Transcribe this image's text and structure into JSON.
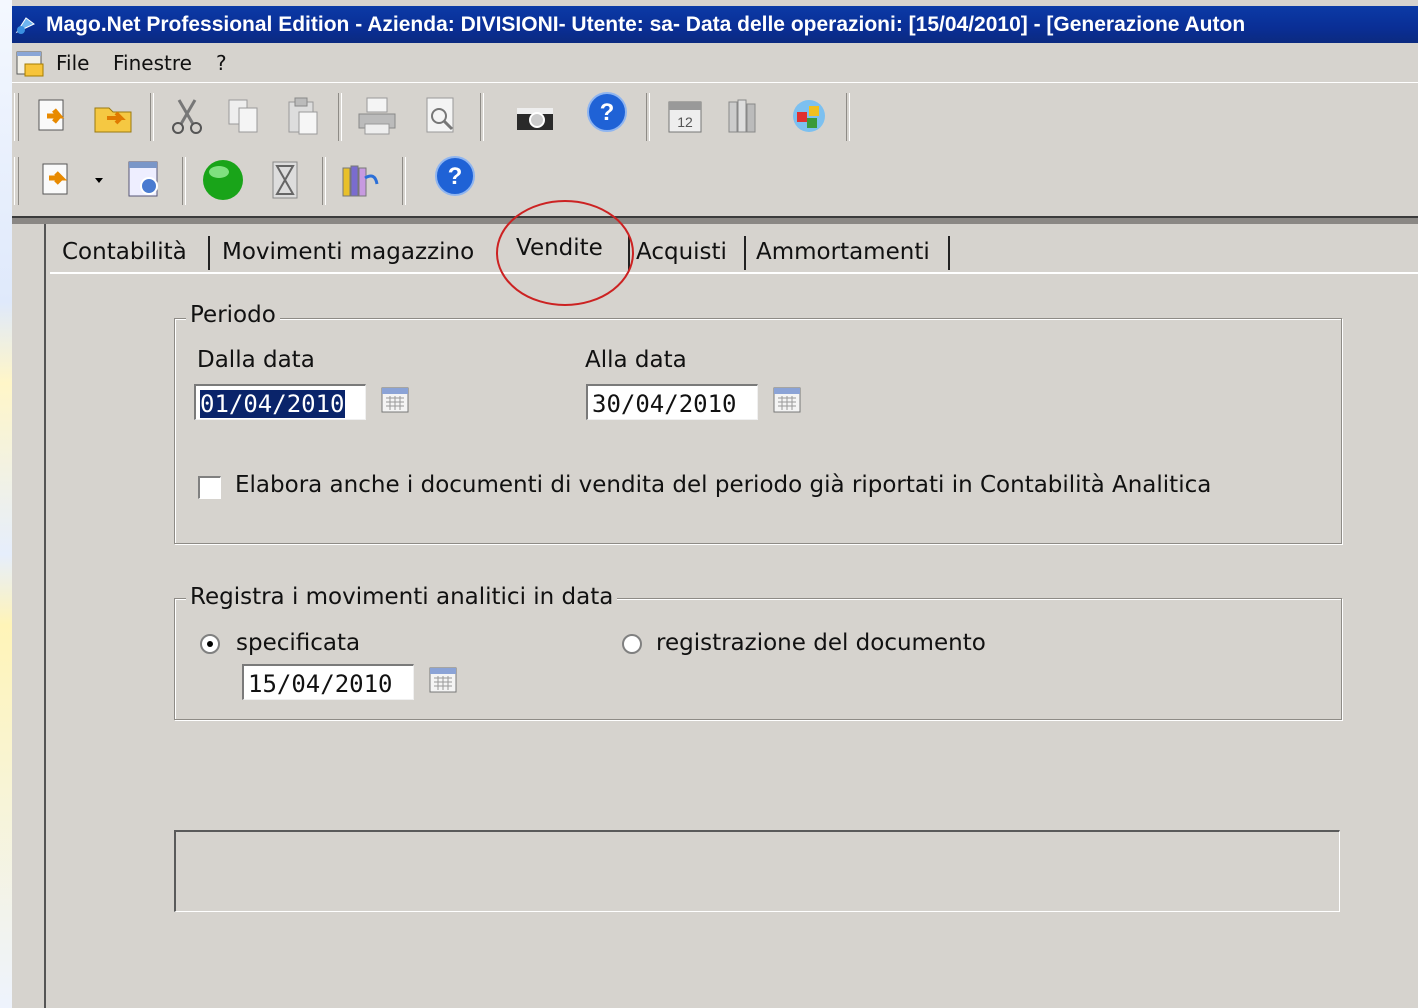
{
  "window": {
    "title": "Mago.Net Professional Edition - Azienda: DIVISIONI- Utente: sa- Data delle operazioni: [15/04/2010] - [Generazione Auton"
  },
  "menu": {
    "items": [
      "File",
      "Finestre",
      "?"
    ]
  },
  "toolbar": {
    "row1_icons": [
      "open-folder-icon",
      "folder-arrow-icon",
      "cut-icon",
      "copy-icon",
      "paste-icon",
      "print-icon",
      "print-preview-icon",
      "camera-icon",
      "help-icon",
      "calendar-icon",
      "books-icon",
      "components-icon"
    ],
    "row2_icons": [
      "new-document-icon",
      "dropdown-arrow-icon",
      "settings-document-icon",
      "run-green-icon",
      "hourglass-icon",
      "books-arrow-icon",
      "help-icon"
    ]
  },
  "tabs": [
    "Contabilità",
    "Movimenti magazzino",
    "Vendite",
    "Acquisti",
    "Ammortamenti"
  ],
  "active_tab": "Vendite",
  "periodo": {
    "group_title": "Periodo",
    "from_label": "Dalla data",
    "from_value": "01/04/2010",
    "to_label": "Alla data",
    "to_value": "30/04/2010",
    "checkbox_label": "Elabora anche i documenti di vendita del periodo già riportati in Contabilità Analitica",
    "checkbox_checked": false
  },
  "registra": {
    "group_title": "Registra i movimenti analitici in data",
    "option_specified": "specificata",
    "option_document": "registrazione del documento",
    "selected": "specificata",
    "date_value": "15/04/2010"
  },
  "colors": {
    "titlebar": "#0a2e95",
    "window_bg": "#d6d3ce",
    "selection": "#0a246a",
    "annotation_circle": "#cc2222"
  }
}
